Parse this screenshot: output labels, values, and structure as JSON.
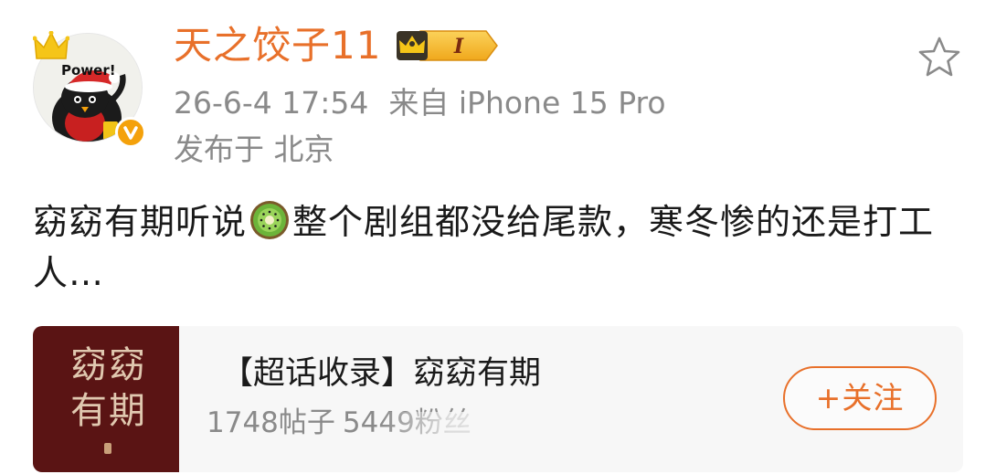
{
  "user": {
    "avatar_text": "Power!",
    "name": "天之饺子11",
    "level_label": "I"
  },
  "post": {
    "timestamp": "26-6-4 17:54",
    "source": "来自 iPhone 15 Pro",
    "location": "发布于 北京",
    "text_part1": "窈窈有期听说",
    "emoji_name": "kiwi-icon",
    "text_part2": "整个剧组都没给尾款，寒冬惨的还是打工人…"
  },
  "topic_card": {
    "cover_text": "窈窈有期",
    "title": "【超话收录】窈窈有期",
    "posts_count": "1748帖子",
    "fans_count": "5449粉丝",
    "follow_label": "+关注"
  },
  "colors": {
    "username": "#e8702a",
    "meta_gray": "#8a8a8a",
    "follow_accent": "#e8702a",
    "cover_bg": "#5a1414"
  }
}
